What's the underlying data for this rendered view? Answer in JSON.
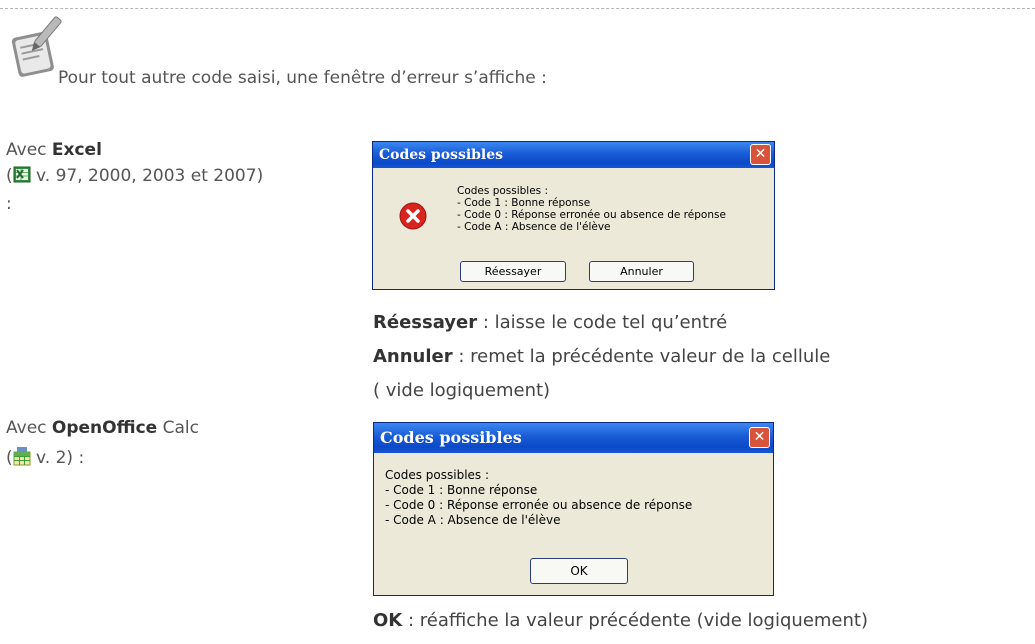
{
  "intro_text": "Pour tout autre code saisi, une fenêtre d’erreur s’affiche :",
  "excel_block": {
    "prefix": "Avec ",
    "app": "Excel",
    "open_paren": "(",
    "versions": " v. 97, 2000, 2003 et 2007)",
    "colon": ":"
  },
  "excel_dialog": {
    "title": "Codes possibles",
    "close": "✕",
    "lines": [
      "Codes possibles :",
      "- Code 1 : Bonne réponse",
      "- Code 0 : Réponse erronée ou absence de réponse",
      "- Code A : Absence de l'élève"
    ],
    "retry_label": "Réessayer",
    "cancel_label": "Annuler"
  },
  "excel_notes": {
    "retry_term": "Réessayer",
    "retry_desc": " : laisse le code tel qu’entré",
    "cancel_term": "Annuler",
    "cancel_desc": " : remet la précédente valeur de la cellule",
    "cancel_desc2": "( vide logiquement)"
  },
  "calc_block": {
    "prefix": "Avec ",
    "app": "OpenOffice",
    "suffix": " Calc",
    "open_paren": "(",
    "version": " v. 2) :"
  },
  "calc_dialog": {
    "title": "Codes possibles",
    "close": "✕",
    "lines": [
      "Codes possibles :",
      "- Code 1 : Bonne réponse",
      "- Code 0 : Réponse erronée ou absence de réponse",
      "- Code A : Absence de l'élève"
    ],
    "ok_label": "OK"
  },
  "calc_notes": {
    "ok_term": "OK",
    "ok_desc": " : réaffiche la valeur précédente (vide logiquement)"
  },
  "icons": {
    "note": "notepad-pencil-icon",
    "excel": "excel-icon",
    "calc": "calc-icon",
    "error": "error-icon"
  }
}
